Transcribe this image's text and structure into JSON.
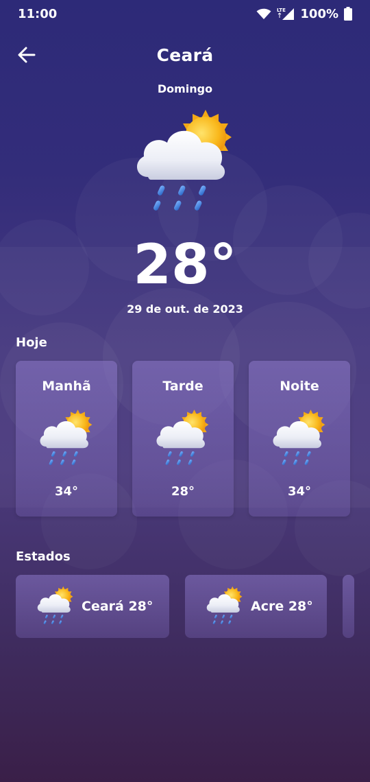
{
  "status_bar": {
    "time": "11:00",
    "battery": "100%",
    "network": "LTE"
  },
  "header": {
    "title": "Ceará",
    "back_icon": "arrow-left-icon"
  },
  "current": {
    "day": "Domingo",
    "temperature": "28°",
    "date": "29 de out. de 2023",
    "icon": "sun-cloud-rain-icon"
  },
  "today": {
    "title": "Hoje",
    "periods": [
      {
        "name": "Manhã",
        "temperature": "34°",
        "icon": "sun-cloud-rain-icon"
      },
      {
        "name": "Tarde",
        "temperature": "28°",
        "icon": "sun-cloud-rain-icon"
      },
      {
        "name": "Noite",
        "temperature": "34°",
        "icon": "sun-cloud-rain-icon"
      }
    ]
  },
  "states": {
    "title": "Estados",
    "items": [
      {
        "label": "Ceará 28°",
        "icon": "sun-cloud-rain-icon"
      },
      {
        "label": "Acre 28°",
        "icon": "sun-cloud-rain-icon"
      }
    ]
  },
  "colors": {
    "background_top": "#2d2a78",
    "background_bottom": "#3a1f48",
    "sun": "#f7b21b",
    "cloud": "#eef0f8",
    "rain": "#3b7fd6"
  }
}
